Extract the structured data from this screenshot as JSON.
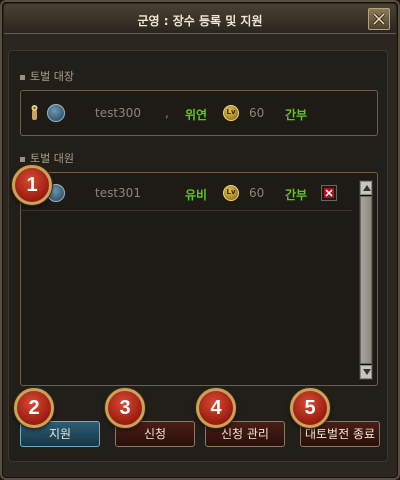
{
  "window": {
    "title": "군영 : 장수 등록 및 지원",
    "close_icon": "close-icon"
  },
  "leader_section": {
    "label": "토벌 대장",
    "member": {
      "name": "test300",
      "separator": ",",
      "country": "위연",
      "level": "60",
      "rank": "간부"
    }
  },
  "members_section": {
    "label": "토벌 대원",
    "members": [
      {
        "name": "test301",
        "country": "유비",
        "level": "60",
        "rank": "간부"
      }
    ]
  },
  "level_icon_text": "Lv",
  "buttons": {
    "support": "지원",
    "apply": "신청",
    "manage": "신청 관리",
    "end": "대토벌전 종료"
  },
  "badges": [
    "1",
    "2",
    "3",
    "4",
    "5"
  ],
  "colors": {
    "green_text": "#5ec71c",
    "badge_red": "#d94a33",
    "badge_ring": "#c9a35b"
  }
}
